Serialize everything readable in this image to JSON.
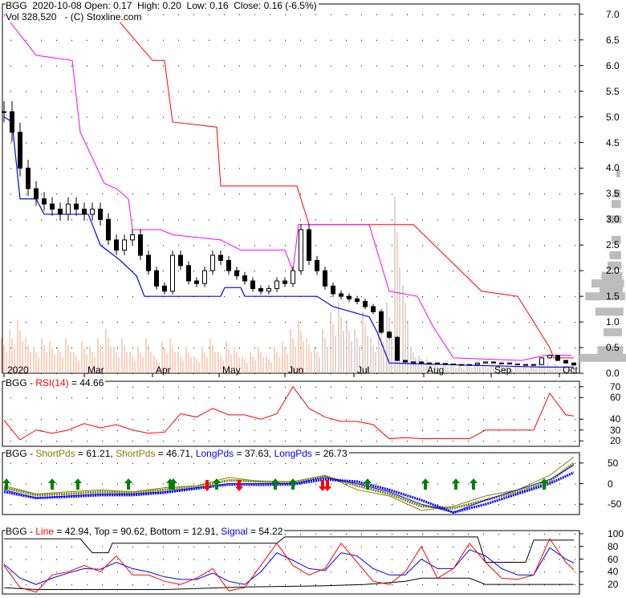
{
  "header": {
    "symbol": "BGG",
    "date": "2020-10-08",
    "open": "Open: 0.17",
    "high": "High: 0.20",
    "low": "Low: 0.16",
    "close": "Close: 0.16 (-6.5%)",
    "volume": "Vol 328,520",
    "copyright": "- (C) Stoxline.com"
  },
  "rsi_header": {
    "prefix": "BGG - ",
    "name": "RSI(14)",
    "value": " = 44.66"
  },
  "osc_header": {
    "prefix": "BGG - ",
    "s1": "ShortPds",
    "v1": " = 61.21, ",
    "s2": "ShortPds",
    "v2": " = 46.71, ",
    "l1": "LongPds",
    "v3": " = 37.63, ",
    "l2": "LongPds",
    "v4": " = 26.73"
  },
  "stoch_header": {
    "prefix": "BGG - ",
    "line": "Line",
    "v1": " = 42.94, Top = 90.62, Bottom = 12.91, ",
    "signal": "Signal",
    "v2": " = 54.22"
  },
  "colors": {
    "red": "#ff0000",
    "magenta": "#ff00ff",
    "blue": "#0000ff",
    "olive": "#808000",
    "volume": "#f4a582",
    "volume_late": "#b0b0b0",
    "profile": "#bdbdbd",
    "green": "#008000"
  },
  "chart_data": [
    {
      "type": "candlestick",
      "title": "BGG price",
      "ylim": [
        0,
        7.2
      ],
      "yticks": [
        "0.0",
        "0.5",
        "1.0",
        "1.5",
        "2.0",
        "2.5",
        "3.0",
        "3.5",
        "4.0",
        "4.5",
        "5.0",
        "5.5",
        "6.0",
        "6.5",
        "7.0"
      ],
      "xticks": [
        "2020",
        "Mar",
        "Apr",
        "May",
        "Jun",
        "Jul",
        "Aug",
        "Sep",
        "Oct"
      ],
      "xtick_index": [
        0,
        10,
        18.5,
        26.8,
        35,
        43.6,
        52.3,
        60.7,
        69.2
      ],
      "close": [
        5.1,
        4.7,
        4.0,
        3.6,
        3.4,
        3.3,
        3.2,
        3.1,
        3.3,
        3.2,
        3.1,
        3.2,
        3.0,
        2.6,
        2.4,
        2.6,
        2.7,
        2.3,
        2.0,
        1.7,
        1.6,
        2.3,
        2.1,
        1.8,
        1.75,
        2.0,
        2.3,
        2.2,
        2.0,
        1.9,
        1.8,
        1.65,
        1.6,
        1.65,
        1.8,
        1.75,
        2.0,
        2.8,
        2.2,
        2.0,
        1.7,
        1.55,
        1.5,
        1.45,
        1.4,
        1.3,
        1.2,
        0.8,
        0.7,
        0.25,
        0.22,
        0.22,
        0.2,
        0.2,
        0.19,
        0.18,
        0.17,
        0.16,
        0.17,
        0.2,
        0.22,
        0.2,
        0.2,
        0.18,
        0.17,
        0.16,
        0.17,
        0.3,
        0.35,
        0.25,
        0.2,
        0.16
      ],
      "volume_rel": [
        0.2,
        0.25,
        0.3,
        0.2,
        0.15,
        0.2,
        0.18,
        0.15,
        0.2,
        0.12,
        0.18,
        0.15,
        0.2,
        0.25,
        0.15,
        0.2,
        0.12,
        0.15,
        0.2,
        0.1,
        0.18,
        0.2,
        0.12,
        0.15,
        0.1,
        0.15,
        0.2,
        0.12,
        0.18,
        0.15,
        0.1,
        0.12,
        0.15,
        0.1,
        0.15,
        0.18,
        0.25,
        0.3,
        0.2,
        0.15,
        0.25,
        0.35,
        0.4,
        0.3,
        0.25,
        0.35,
        0.2,
        0.3,
        0.4,
        1.0,
        0.5,
        0.15,
        0.1,
        0.08,
        0.05,
        0.06,
        0.05,
        0.04,
        0.05,
        0.06,
        0.05,
        0.04,
        0.05,
        0.04,
        0.05,
        0.04,
        0.05,
        0.08,
        0.06,
        0.05,
        0.04,
        0.04
      ],
      "upper_red": [
        [
          12.5,
          7.2
        ],
        [
          18.5,
          6.1
        ],
        [
          20,
          6.1
        ],
        [
          21,
          4.9
        ],
        [
          26.5,
          4.8
        ],
        [
          27,
          3.65
        ],
        [
          36.5,
          3.65
        ],
        [
          38,
          2.9
        ],
        [
          51,
          2.9
        ],
        [
          59.5,
          1.6
        ],
        [
          64,
          1.5
        ],
        [
          68,
          0.5
        ],
        [
          68.5,
          0.3
        ],
        [
          71,
          0.3
        ]
      ],
      "mid_magenta": [
        [
          0,
          7.0
        ],
        [
          2.5,
          6.5
        ],
        [
          4,
          6.2
        ],
        [
          8.5,
          6.1
        ],
        [
          9.5,
          4.7
        ],
        [
          12.5,
          3.7
        ],
        [
          14,
          3.6
        ],
        [
          15.5,
          3.4
        ],
        [
          16,
          2.8
        ],
        [
          19.5,
          2.8
        ],
        [
          21,
          2.7
        ],
        [
          27,
          2.6
        ],
        [
          29.5,
          2.4
        ],
        [
          35,
          2.4
        ],
        [
          36,
          2.0
        ],
        [
          36.7,
          2.9
        ],
        [
          45.5,
          2.9
        ],
        [
          48,
          1.6
        ],
        [
          51.5,
          1.5
        ],
        [
          53.5,
          0.9
        ],
        [
          56,
          0.3
        ],
        [
          64.5,
          0.25
        ],
        [
          67.5,
          0.35
        ],
        [
          70.7,
          0.35
        ]
      ],
      "lower_blue": [
        [
          0,
          5.0
        ],
        [
          1,
          4.9
        ],
        [
          2,
          3.4
        ],
        [
          4,
          3.4
        ],
        [
          5,
          3.1
        ],
        [
          10.5,
          3.1
        ],
        [
          12,
          2.5
        ],
        [
          14.5,
          2.2
        ],
        [
          16.5,
          1.9
        ],
        [
          17.5,
          1.5
        ],
        [
          27,
          1.5
        ],
        [
          27.5,
          1.67
        ],
        [
          29.5,
          1.67
        ],
        [
          30,
          1.5
        ],
        [
          39,
          1.5
        ],
        [
          41,
          1.3
        ],
        [
          45.5,
          1.1
        ],
        [
          46.5,
          0.8
        ],
        [
          48,
          0.2
        ],
        [
          59.5,
          0.15
        ],
        [
          67,
          0.12
        ],
        [
          71,
          0.12
        ]
      ],
      "volume_profile_price": [
        0.3,
        0.45,
        0.8,
        1.2,
        1.5,
        1.6,
        1.75,
        1.9,
        2.1,
        2.3,
        2.6,
        3.0,
        3.3,
        3.5,
        3.9
      ],
      "volume_profile_rel": [
        1.0,
        0.55,
        0.4,
        0.6,
        0.85,
        0.5,
        0.7,
        0.45,
        0.3,
        0.25,
        0.2,
        0.3,
        0.2,
        0.15,
        0.08
      ]
    },
    {
      "type": "line",
      "title": "RSI(14)",
      "ylim": [
        15,
        75
      ],
      "yticks": [
        "20",
        "30",
        "40",
        "60",
        "70"
      ],
      "ytick_values": [
        20,
        30,
        40,
        60,
        70
      ],
      "x_index": [
        0,
        2,
        4,
        6,
        8,
        10,
        12,
        14,
        16,
        18,
        20,
        22,
        24,
        26,
        28,
        30,
        32,
        34,
        36,
        38,
        40,
        42,
        44,
        46,
        48,
        50,
        52,
        54,
        56,
        58,
        60,
        62,
        64,
        66,
        68,
        70,
        71
      ],
      "rsi": [
        39,
        21,
        30,
        27,
        30,
        36,
        32,
        35,
        30,
        27,
        28,
        45,
        42,
        50,
        44,
        44,
        40,
        45,
        70,
        50,
        42,
        38,
        38,
        35,
        22,
        23,
        22,
        22,
        22,
        22,
        30,
        30,
        30,
        30,
        64,
        44,
        43
      ]
    },
    {
      "type": "line",
      "title": "ShortPds/LongPds",
      "ylim": [
        -75,
        75
      ],
      "yticks": [
        "50",
        "0",
        "-50"
      ],
      "ytick_values": [
        50,
        0,
        -50
      ],
      "x_index": [
        0,
        4,
        8,
        12,
        16,
        20,
        24,
        28,
        32,
        36,
        40,
        44,
        48,
        52,
        56,
        60,
        64,
        68,
        71
      ],
      "short1": [
        -5,
        -25,
        -20,
        -15,
        -20,
        -10,
        -5,
        15,
        5,
        5,
        20,
        -15,
        -30,
        -65,
        -55,
        -30,
        -15,
        20,
        65
      ],
      "short2": [
        -10,
        -28,
        -25,
        -20,
        -22,
        -15,
        -8,
        8,
        5,
        2,
        18,
        -5,
        -25,
        -55,
        -60,
        -40,
        -20,
        5,
        50
      ],
      "long1": [
        -15,
        -35,
        -30,
        -25,
        -25,
        -20,
        -10,
        0,
        0,
        0,
        15,
        0,
        -20,
        -50,
        -70,
        -40,
        -15,
        10,
        45
      ],
      "long2": [
        -20,
        -35,
        -32,
        -28,
        -28,
        -22,
        -12,
        -2,
        -3,
        -2,
        10,
        5,
        -15,
        -40,
        -70,
        -50,
        -25,
        0,
        27
      ],
      "up_arrows": [
        0.3,
        6,
        9.2,
        15.5,
        20.7,
        21.1,
        26.5,
        33.8,
        36,
        45.3,
        52.5,
        56.3,
        58.5,
        67.3
      ],
      "down_arrows": [
        25.3,
        29.3,
        39.7,
        40.3
      ]
    },
    {
      "type": "line",
      "title": "Stochastic",
      "ylim": [
        5,
        105
      ],
      "yticks": [
        "100",
        "80",
        "60",
        "40",
        "20"
      ],
      "ytick_values": [
        100,
        80,
        60,
        40,
        20
      ],
      "x_index": [
        0,
        2,
        4,
        6,
        8,
        10,
        12,
        14,
        16,
        18,
        20,
        22,
        24,
        26,
        28,
        30,
        32,
        34,
        36,
        38,
        40,
        42,
        44,
        46,
        48,
        50,
        52,
        54,
        56,
        58,
        60,
        62,
        64,
        66,
        68,
        70,
        71
      ],
      "line": [
        50,
        15,
        8,
        35,
        40,
        50,
        40,
        65,
        35,
        35,
        25,
        20,
        30,
        45,
        10,
        15,
        50,
        85,
        50,
        35,
        45,
        85,
        55,
        25,
        20,
        40,
        80,
        30,
        45,
        85,
        55,
        30,
        28,
        35,
        92,
        55,
        43
      ],
      "signal": [
        52,
        30,
        20,
        30,
        38,
        45,
        44,
        55,
        45,
        40,
        32,
        28,
        28,
        38,
        25,
        20,
        40,
        70,
        58,
        45,
        42,
        70,
        65,
        45,
        35,
        35,
        60,
        45,
        45,
        75,
        65,
        45,
        35,
        35,
        78,
        60,
        54
      ],
      "top": [
        [
          0,
          92
        ],
        [
          9.5,
          92
        ],
        [
          11,
          70
        ],
        [
          13,
          70
        ],
        [
          13.5,
          85
        ],
        [
          34,
          85
        ],
        [
          35,
          95
        ],
        [
          59,
          95
        ],
        [
          60,
          55
        ],
        [
          65,
          55
        ],
        [
          66,
          90
        ],
        [
          71,
          90
        ]
      ],
      "bottom": [
        [
          0,
          15
        ],
        [
          4,
          12
        ],
        [
          15,
          12
        ],
        [
          20,
          12
        ],
        [
          25,
          14
        ],
        [
          30,
          16
        ],
        [
          40,
          18
        ],
        [
          45,
          20
        ],
        [
          50,
          25
        ],
        [
          52,
          30
        ],
        [
          58,
          30
        ],
        [
          60,
          20
        ],
        [
          71,
          20
        ]
      ]
    }
  ]
}
